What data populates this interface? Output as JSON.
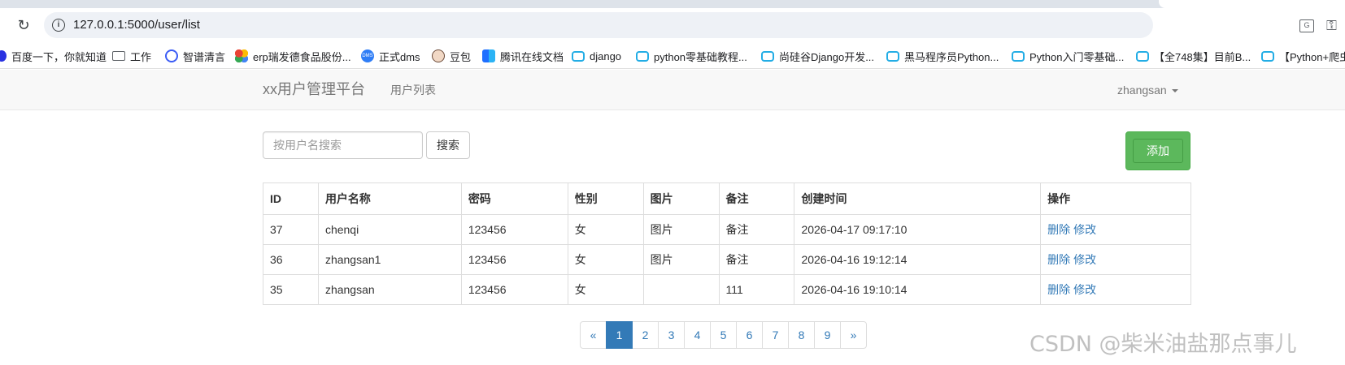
{
  "browser": {
    "url": "127.0.0.1:5000/user/list",
    "bookmarks": [
      {
        "label": "百度一下，你就知道",
        "icon": "baidu-paw-icon"
      },
      {
        "label": "工作",
        "icon": "folder-icon"
      },
      {
        "label": "智谱清言",
        "icon": "zhipu-icon"
      },
      {
        "label": "erp瑞发德食品股份...",
        "icon": "erp-icon"
      },
      {
        "label": "正式dms",
        "icon": "dms-icon"
      },
      {
        "label": "豆包",
        "icon": "doubao-icon"
      },
      {
        "label": "腾讯在线文档",
        "icon": "tencent-docs-icon"
      },
      {
        "label": "django",
        "icon": "bilibili-icon"
      },
      {
        "label": "python零基础教程...",
        "icon": "bilibili-icon"
      },
      {
        "label": "尚硅谷Django开发...",
        "icon": "bilibili-icon"
      },
      {
        "label": "黑马程序员Python...",
        "icon": "bilibili-icon"
      },
      {
        "label": "Python入门零基础...",
        "icon": "bilibili-icon"
      },
      {
        "label": "【全748集】目前B...",
        "icon": "bilibili-icon"
      },
      {
        "label": "【Python+爬虫",
        "icon": "bilibili-icon"
      }
    ]
  },
  "navbar": {
    "brand": "xx用户管理平台",
    "link": "用户列表",
    "user": "zhangsan"
  },
  "search": {
    "placeholder": "按用户名搜索",
    "button": "搜索"
  },
  "add_button": "添加",
  "table": {
    "headers": [
      "ID",
      "用户名称",
      "密码",
      "性别",
      "图片",
      "备注",
      "创建时间",
      "操作"
    ],
    "rows": [
      {
        "id": "37",
        "name": "chenqi",
        "password": "123456",
        "gender": "女",
        "image": "图片",
        "remark": "备注",
        "created": "2026-04-17 09:17:10"
      },
      {
        "id": "36",
        "name": "zhangsan1",
        "password": "123456",
        "gender": "女",
        "image": "图片",
        "remark": "备注",
        "created": "2026-04-16 19:12:14"
      },
      {
        "id": "35",
        "name": "zhangsan",
        "password": "123456",
        "gender": "女",
        "image": "",
        "remark": "111",
        "created": "2026-04-16 19:10:14"
      }
    ],
    "actions": {
      "delete": "删除",
      "edit": "修改"
    }
  },
  "pagination": {
    "prev": "«",
    "pages": [
      "1",
      "2",
      "3",
      "4",
      "5",
      "6",
      "7",
      "8",
      "9"
    ],
    "next": "»",
    "current": "1"
  },
  "watermark": "CSDN @柴米油盐那点事儿"
}
